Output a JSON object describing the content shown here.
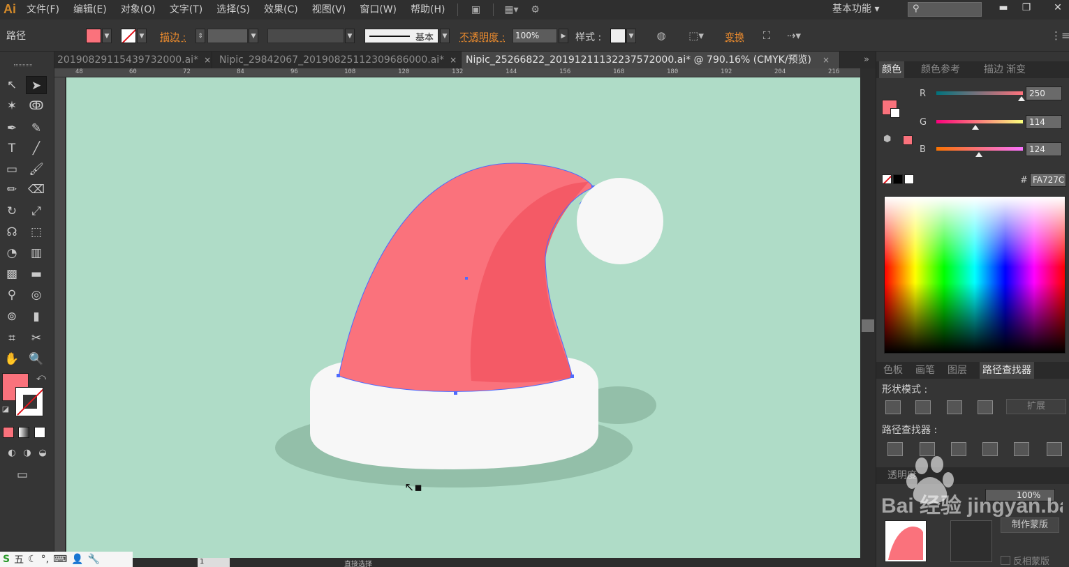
{
  "app": {
    "logo": "Ai",
    "workspace": "基本功能 ▾"
  },
  "menu": [
    "文件(F)",
    "编辑(E)",
    "对象(O)",
    "文字(T)",
    "选择(S)",
    "效果(C)",
    "视图(V)",
    "窗口(W)",
    "帮助(H)"
  ],
  "control_bar": {
    "object_type": "路径",
    "stroke_label": "描边 :",
    "stroke_profile": "基本",
    "opacity_label": "不透明度 :",
    "opacity_value": "100%",
    "style_label": "样式 :",
    "transform_label": "变换",
    "fill_color": "#fa727c"
  },
  "document_tabs": [
    {
      "label": "20190829115439732000.ai*",
      "close": "×"
    },
    {
      "label": "Nipic_29842067_20190825112309686000.ai*",
      "close": "×"
    },
    {
      "label": "Nipic_25266822_20191211132237572000.ai* @ 790.16% (CMYK/预览)",
      "close": "×"
    }
  ],
  "tab_overflow": "»",
  "ruler_ticks": [
    "48",
    "60",
    "72",
    "84",
    "96",
    "108",
    "120",
    "132",
    "144",
    "156",
    "168",
    "180",
    "192",
    "204",
    "216"
  ],
  "canvas": {
    "background": "#afdcc7",
    "hat_color": "#fa727c",
    "hat_shade_color": "#f45a66",
    "fur_color": "#f7f7f7",
    "shadow_color": "#93bfa9",
    "path_color": "#4d6bff"
  },
  "color_panel": {
    "tabs": [
      "颜色",
      "颜色参考",
      "描边",
      "渐变"
    ],
    "r_label": "R",
    "r": "250",
    "g_label": "G",
    "g": "114",
    "b_label": "B",
    "b": "124",
    "r_level": 0.98,
    "g_level": 0.45,
    "b_level": 0.49,
    "hex_label": "#",
    "hex": "FA727C"
  },
  "pathfinder_panel": {
    "tabs": [
      "色板",
      "画笔",
      "图层",
      "路径查找器"
    ],
    "shape_modes_label": "形状模式 :",
    "expand_label": "扩展",
    "pathfinders_label": "路径查找器 :"
  },
  "transparency_panel": {
    "tab": "透明度",
    "opacity_value": "100%",
    "make_mask_label": "制作蒙版",
    "invert_mask_label": "反相蒙版"
  },
  "status_bar": {
    "page": "1",
    "mode": "直接选择"
  },
  "watermark": "Bai 经验 jingyan.baidu"
}
